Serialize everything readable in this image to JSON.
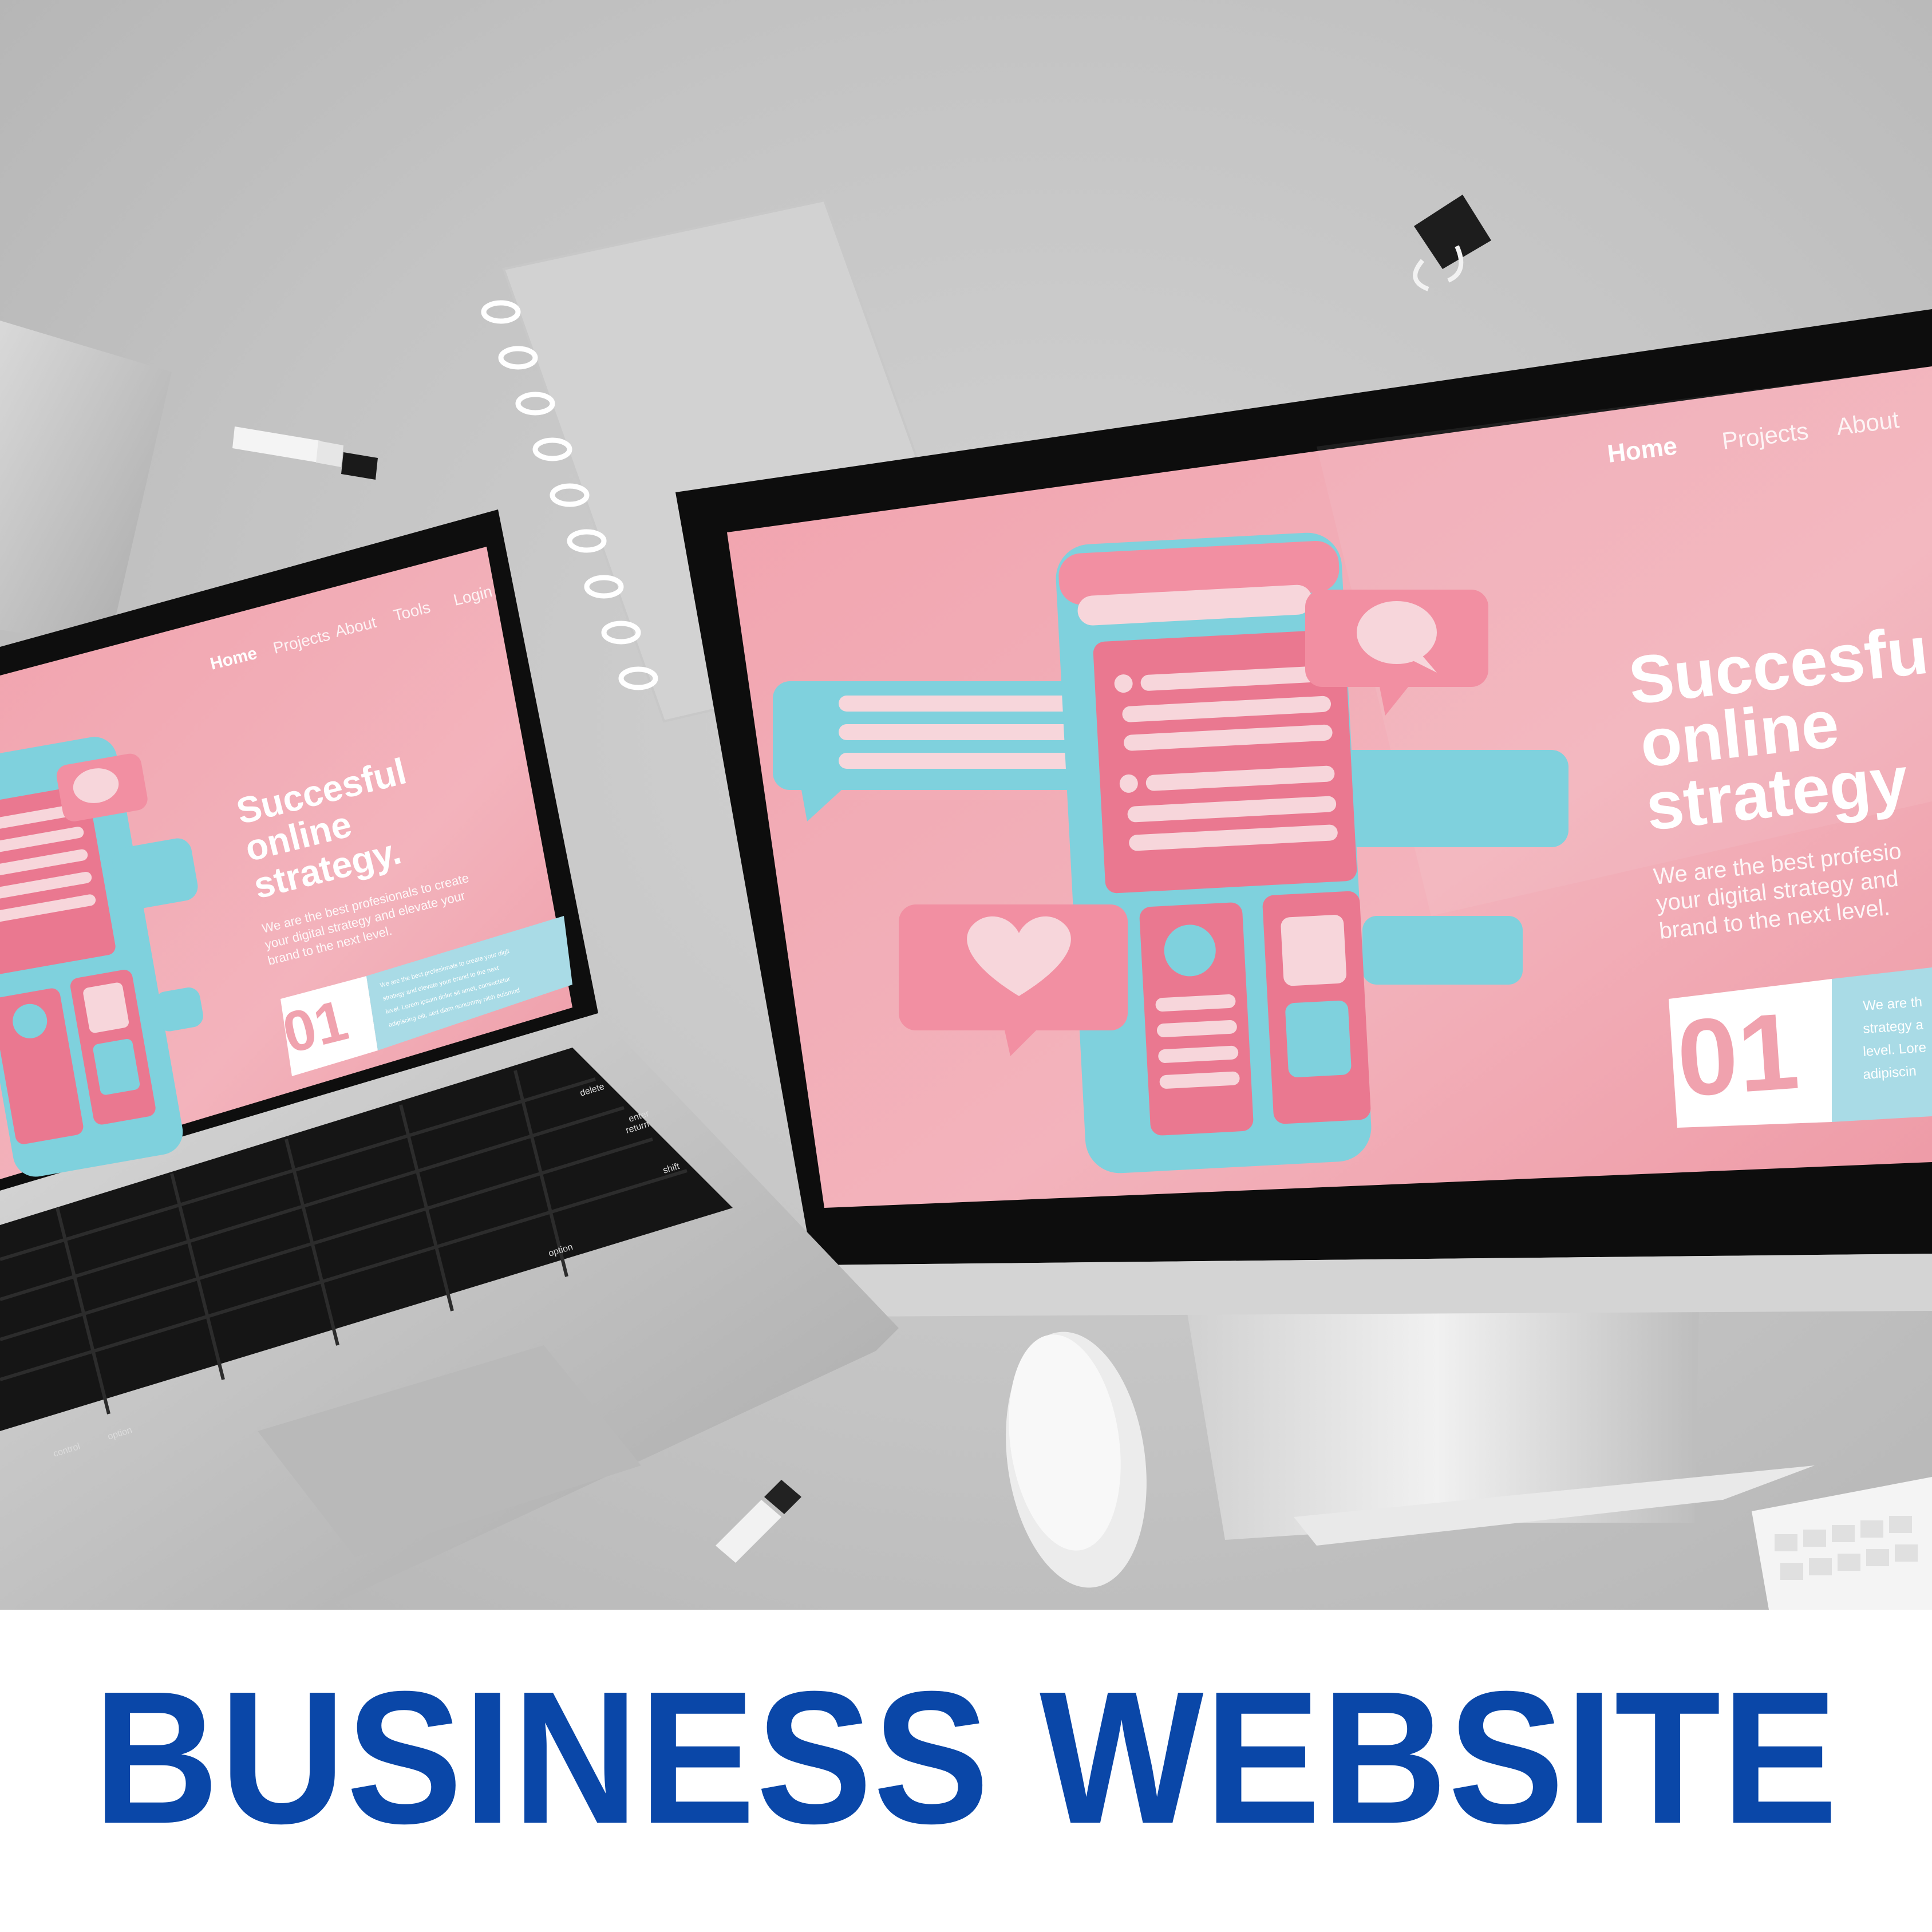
{
  "banner": {
    "headline": "BUSINESS WEBSITE",
    "headline_color": "#0a47a8"
  },
  "monitor_site": {
    "nav": [
      "Home",
      "Projects",
      "About"
    ],
    "hero_title": [
      "Succesfu",
      "online",
      "strategy"
    ],
    "hero_text": [
      "We are the best profesio",
      "your digital strategy and",
      "brand to the next level."
    ],
    "section_number": "01",
    "panel_text": [
      "We are th",
      "strategy a",
      "level. Lore",
      "adipiscin"
    ]
  },
  "laptop_site": {
    "nav": [
      "Home",
      "Projects",
      "About",
      "Tools",
      "Login"
    ],
    "hero_title": [
      "Succesful",
      "online",
      "strategy."
    ],
    "hero_text": [
      "We are the best profesionals to create",
      "your digital strategy and elevate your",
      "brand to the next level."
    ],
    "section_number": "01",
    "panel_text": [
      "We are the best profesionals to create your digit",
      "strategy and elevate your brand to the next",
      "level. Lorem ipsum dolor sit amet, consectetur",
      "adipiscing elit, sed diam nonummy nibh euismod"
    ]
  },
  "keyboard_labels": [
    "delete",
    "return",
    "shift",
    "enter",
    "option",
    "control",
    "option"
  ],
  "colors": {
    "site_pink": "#f0a4b0",
    "accent_pink": "#e8788f",
    "accent_teal": "#7fd1dd",
    "light_pink": "#f7d6db"
  }
}
